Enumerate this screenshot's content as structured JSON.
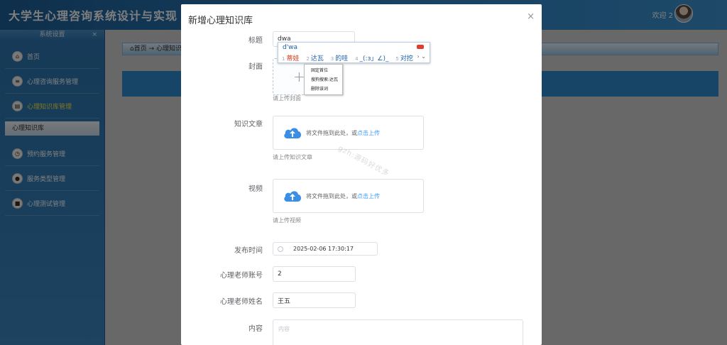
{
  "app": {
    "title": "大学生心理咨询系统设计与实现",
    "welcome": "欢迎 2"
  },
  "sidebar": {
    "header": "系统设置",
    "close": "×",
    "items": [
      {
        "label": "首页",
        "icon": "home-icon"
      },
      {
        "label": "心理咨询服务管理",
        "icon": "list-icon"
      },
      {
        "label": "心理知识库管理",
        "icon": "book-icon"
      },
      {
        "label": "预约服务管理",
        "icon": "calendar-icon"
      },
      {
        "label": "服务类型管理",
        "icon": "tag-icon"
      },
      {
        "label": "心理测试管理",
        "icon": "test-icon"
      }
    ],
    "sub_item": "心理知识库"
  },
  "breadcrumb": "⌂首页 → 心理知识",
  "dialog": {
    "title": "新增心理知识库",
    "close": "×",
    "fields": {
      "title_label": "标题",
      "title_value": "dwa",
      "cover_label": "封面",
      "cover_tip": "请上传封面",
      "article_label": "知识文章",
      "article_upload_text": "将文件拖到此处，或",
      "article_upload_link": "点击上传",
      "article_tip": "请上传知识文章",
      "video_label": "视频",
      "video_upload_text": "将文件拖到此处，或",
      "video_upload_link": "点击上传",
      "video_tip": "请上传视频",
      "publish_label": "发布时间",
      "publish_value": "2025-02-06 17:30:17",
      "teacher_account_label": "心理老师账号",
      "teacher_account_value": "2",
      "teacher_name_label": "心理老师姓名",
      "teacher_name_value": "王五",
      "content_label": "内容",
      "content_placeholder": "内容"
    }
  },
  "ime": {
    "composition": "d'wa",
    "candidates": [
      {
        "num": "1",
        "text": "蒂娃"
      },
      {
        "num": "2",
        "text": "达瓦"
      },
      {
        "num": "3",
        "text": "的哇"
      },
      {
        "num": "4",
        "text": "_(:з」∠)_"
      },
      {
        "num": "5",
        "text": "对挖"
      }
    ],
    "nav": "› ⌄",
    "menu": [
      "固定首位",
      "搜狗搜索:达瓦",
      "删除该词"
    ]
  },
  "watermark": "gzh:源码好优多",
  "colors": {
    "accent": "#409eff",
    "header_blue": "#2f86c8",
    "cloud": "#3a8ee6"
  }
}
